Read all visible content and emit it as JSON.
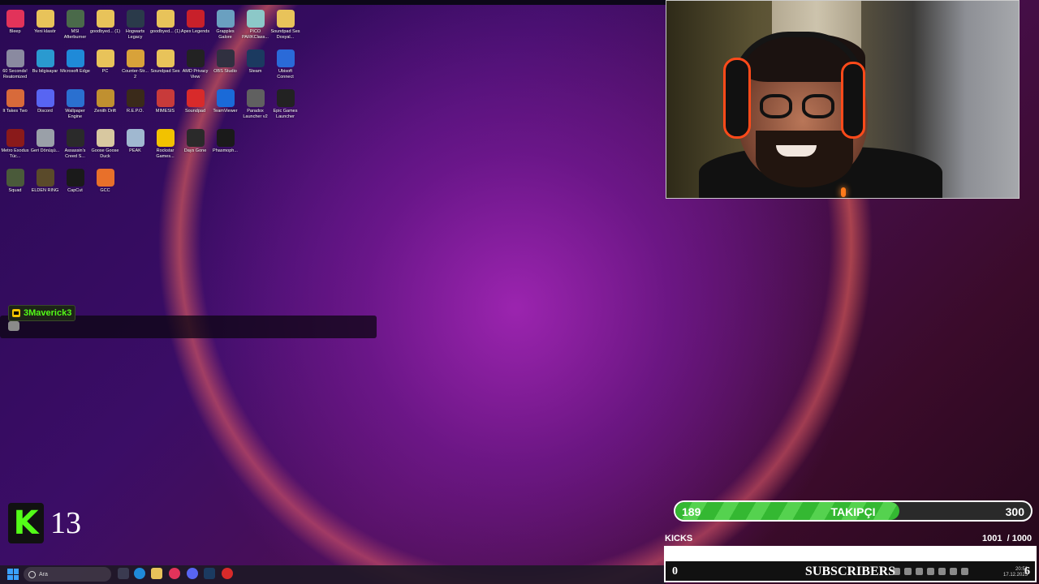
{
  "desktop": {
    "rows": [
      [
        {
          "label": "Bleep",
          "icon": "bleep-icon",
          "color": "#e2335a"
        },
        {
          "label": "Yeni klasör",
          "icon": "folder-icon",
          "color": "#e8c35a"
        },
        {
          "label": "MSI Afterburner",
          "icon": "msi-afterburner-icon",
          "color": "#4a6a4a"
        },
        {
          "label": "goodbyed... (1)",
          "icon": "folder-icon",
          "color": "#e8c35a"
        },
        {
          "label": "Hogwarts Legacy",
          "icon": "hogwarts-icon",
          "color": "#2a3a4a"
        },
        {
          "label": "goodbyed... (1)",
          "icon": "folder-icon",
          "color": "#e8c35a"
        },
        {
          "label": "Apex Legends",
          "icon": "apex-icon",
          "color": "#c8202a"
        },
        {
          "label": "Grapples Galore",
          "icon": "grapples-icon",
          "color": "#6aa0c0"
        },
        {
          "label": "PICO PARKClass...",
          "icon": "pico-park-icon",
          "color": "#8cc8c8"
        },
        {
          "label": "Soundpad Ses Dosyal...",
          "icon": "folder-icon",
          "color": "#e8c35a"
        }
      ],
      [
        {
          "label": "60 Seconds! Reatomized",
          "icon": "sixty-seconds-icon",
          "color": "#8a8aa0"
        },
        {
          "label": "Bu bilgisayar",
          "icon": "computer-icon",
          "color": "#2a9ad0"
        },
        {
          "label": "Microsoft Edge",
          "icon": "edge-icon",
          "color": "#1f8ad8"
        },
        {
          "label": "PC",
          "icon": "folder-icon",
          "color": "#e8c35a"
        },
        {
          "label": "Counter-Str... 2",
          "icon": "cs2-icon",
          "color": "#d8a23a"
        },
        {
          "label": "Soundpad Ses",
          "icon": "folder-icon",
          "color": "#e8c35a"
        },
        {
          "label": "AMD Privacy View",
          "icon": "amd-icon",
          "color": "#222222"
        },
        {
          "label": "OBS Studio",
          "icon": "obs-icon",
          "color": "#303040"
        },
        {
          "label": "Steam",
          "icon": "steam-icon",
          "color": "#1b3a60"
        },
        {
          "label": "Ubisoft Connect",
          "icon": "ubisoft-icon",
          "color": "#2a6ad8"
        }
      ],
      [
        {
          "label": "It Takes Two",
          "icon": "it-takes-two-icon",
          "color": "#d86a3a"
        },
        {
          "label": "Discord",
          "icon": "discord-icon",
          "color": "#5865f2"
        },
        {
          "label": "Wallpaper Engine",
          "icon": "wallpaper-engine-icon",
          "color": "#2a70d0"
        },
        {
          "label": "Zenith Drift",
          "icon": "zenith-drift-icon",
          "color": "#c09030"
        },
        {
          "label": "R.E.P.O.",
          "icon": "repo-icon",
          "color": "#3a2a1a"
        },
        {
          "label": "MIMESIS",
          "icon": "mimesis-icon",
          "color": "#c83a3a"
        },
        {
          "label": "Soundpad",
          "icon": "soundpad-icon",
          "color": "#d82a2a"
        },
        {
          "label": "TeamViewer",
          "icon": "teamviewer-icon",
          "color": "#1a6ad8"
        },
        {
          "label": "Paradox Launcher v2",
          "icon": "paradox-icon",
          "color": "#606060"
        },
        {
          "label": "Epic Games Launcher",
          "icon": "epic-games-icon",
          "color": "#222222"
        }
      ],
      [
        {
          "label": "Metro Exodus Tüc...",
          "icon": "metro-exodus-icon",
          "color": "#8a1a1a"
        },
        {
          "label": "Geri Dönüşü...",
          "icon": "recycle-bin-icon",
          "color": "#9aa0a8"
        },
        {
          "label": "Assassin's Creed S...",
          "icon": "assassins-creed-icon",
          "color": "#2a2a2a"
        },
        {
          "label": "Goose Goose Duck",
          "icon": "goose-goose-duck-icon",
          "color": "#d8c8a0"
        },
        {
          "label": "PEAK",
          "icon": "peak-icon",
          "color": "#a0b8d0"
        },
        {
          "label": "Rockstar Games...",
          "icon": "rockstar-icon",
          "color": "#f2c200"
        },
        {
          "label": "Days Gone",
          "icon": "days-gone-icon",
          "color": "#2a2a2a"
        },
        {
          "label": "Phasmoph...",
          "icon": "phasmophobia-icon",
          "color": "#1a1a1a"
        }
      ],
      [
        {
          "label": "Squad",
          "icon": "squad-icon",
          "color": "#4a5a3a"
        },
        {
          "label": "ELDEN RING",
          "icon": "elden-ring-icon",
          "color": "#5a4a2a"
        },
        {
          "label": "CapCut",
          "icon": "capcut-icon",
          "color": "#1a1a1a"
        },
        {
          "label": "GCC",
          "icon": "gcc-icon",
          "color": "#e8702a"
        }
      ]
    ]
  },
  "chat": {
    "username": "3Maverick3",
    "username_color": "#53fc18"
  },
  "kick_logo": {
    "letter": "K",
    "number": "13"
  },
  "followers": {
    "current": "189",
    "label": "TAKIPÇI",
    "goal": "300",
    "progress": 0.63
  },
  "kicks": {
    "label": "KICKS",
    "value": "1001  / 1000",
    "progress": 1.0
  },
  "subscribers": {
    "current": "0",
    "label": "SUBSCRIBERS",
    "goal": "6",
    "progress": 0.0
  },
  "taskbar": {
    "search_placeholder": "Ara",
    "time": "20:52",
    "date": "17.12.2025"
  }
}
